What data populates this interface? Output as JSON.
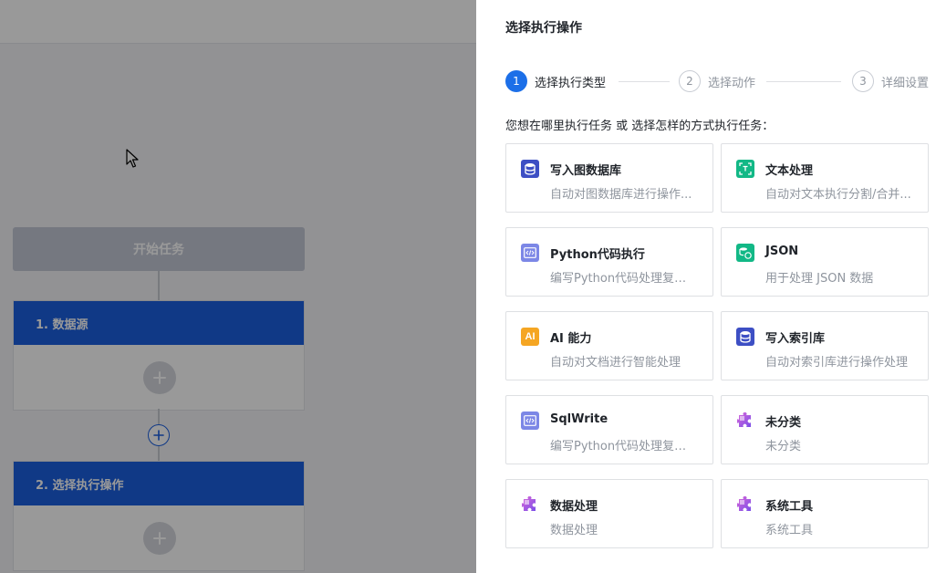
{
  "canvas": {
    "start_node": "开始任务",
    "blocks": [
      {
        "title": "1. 数据源"
      },
      {
        "title": "2. 选择执行操作"
      }
    ]
  },
  "drawer": {
    "title": "选择执行操作",
    "steps": [
      {
        "num": "1",
        "label": "选择执行类型",
        "active": true
      },
      {
        "num": "2",
        "label": "选择动作",
        "active": false
      },
      {
        "num": "3",
        "label": "详细设置",
        "active": false
      }
    ],
    "prompt": "您想在哪里执行任务 或 选择怎样的方式执行任务：",
    "cards": [
      {
        "icon": "database-icon",
        "title": "写入图数据库",
        "desc": "自动对图数据库进行操作..."
      },
      {
        "icon": "text-scan-icon",
        "title": "文本处理",
        "desc": "自动对文本执行分割/合并..."
      },
      {
        "icon": "code-icon",
        "title": "Python代码执行",
        "desc": "编写Python代码处理复杂..."
      },
      {
        "icon": "json-icon",
        "title": "JSON",
        "desc": "用于处理 JSON 数据"
      },
      {
        "icon": "ai-icon",
        "icon_text": "AI",
        "title": "AI 能力",
        "desc": "自动对文档进行智能处理"
      },
      {
        "icon": "database-icon",
        "title": "写入索引库",
        "desc": "自动对索引库进行操作处理"
      },
      {
        "icon": "code-icon",
        "title": "SqlWrite",
        "desc": "编写Python代码处理复杂..."
      },
      {
        "icon": "puzzle-icon",
        "title": "未分类",
        "desc": "未分类"
      },
      {
        "icon": "puzzle-icon",
        "title": "数据处理",
        "desc": "数据处理"
      },
      {
        "icon": "puzzle-icon",
        "title": "系统工具",
        "desc": "系统工具"
      }
    ]
  },
  "colors": {
    "primary": "#1c5fe0",
    "step_active": "#1c6fe8",
    "muted_text": "#8f959e"
  }
}
